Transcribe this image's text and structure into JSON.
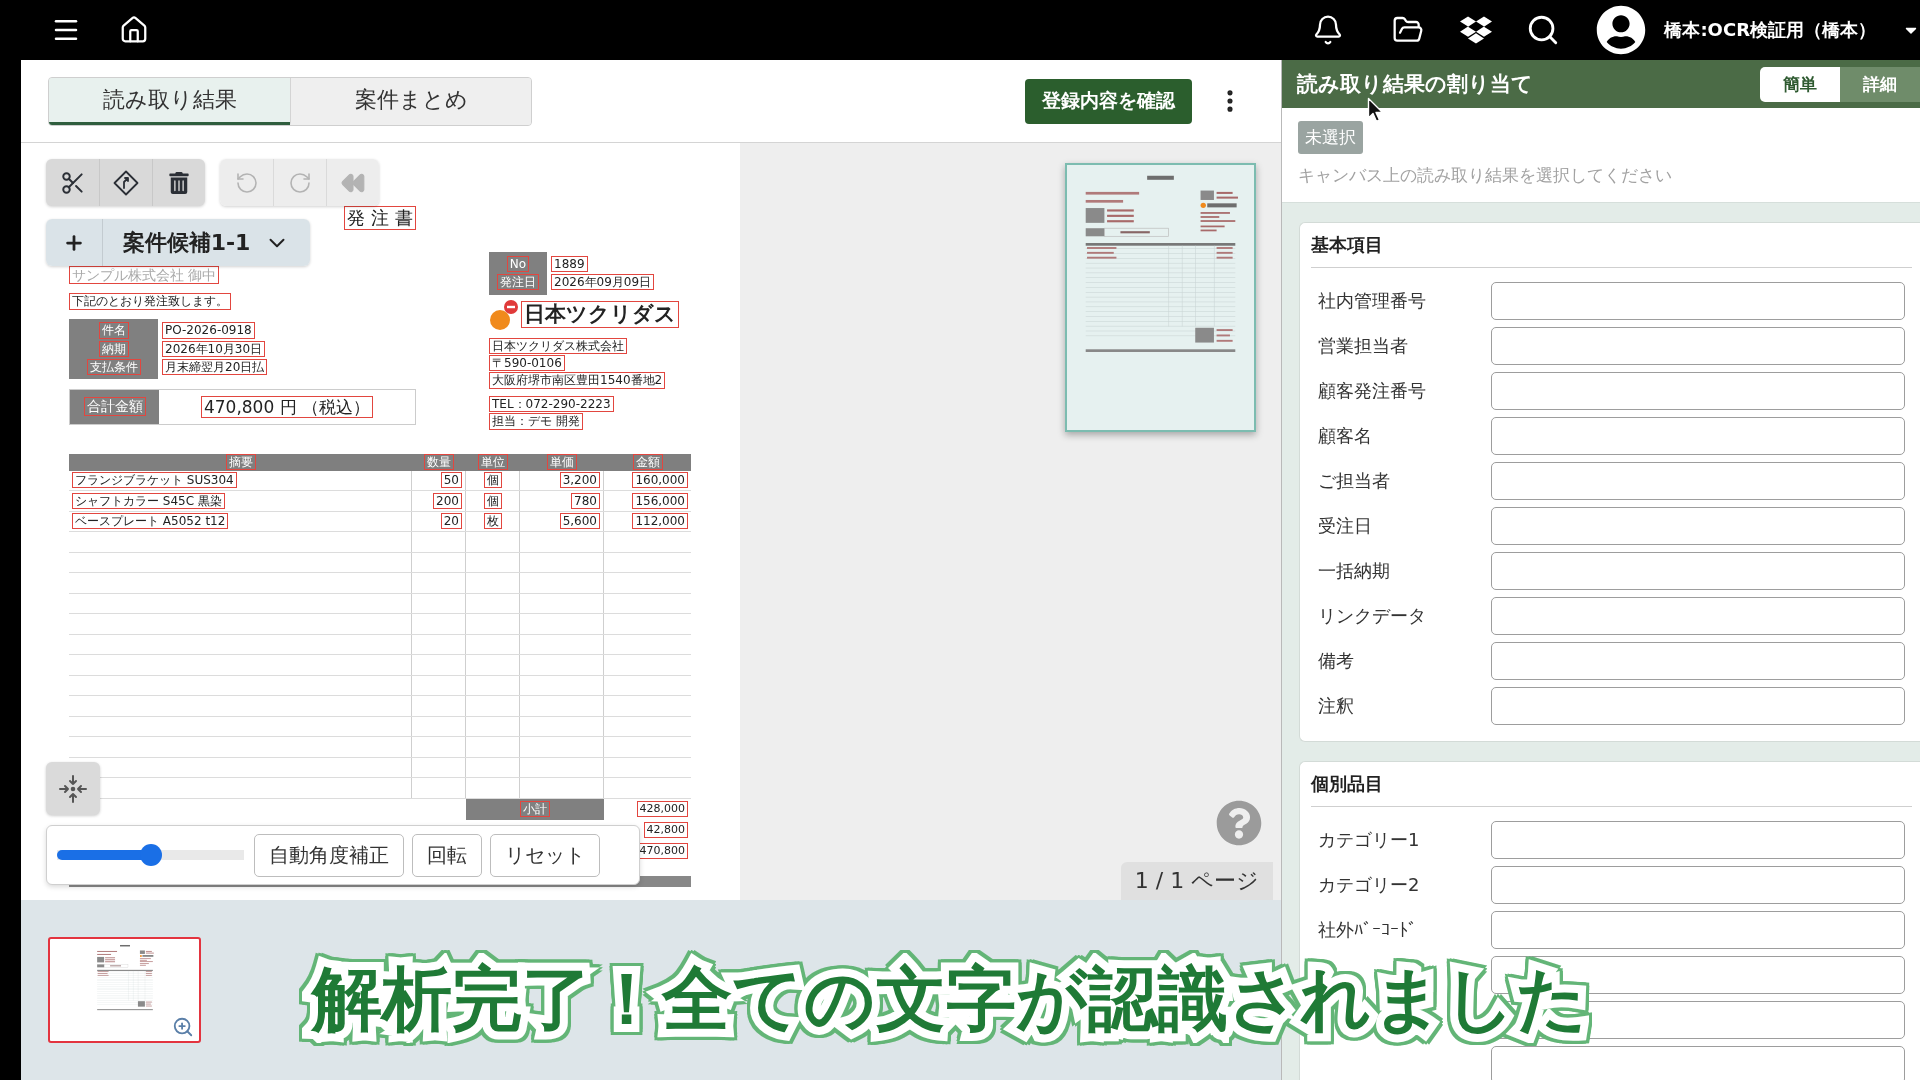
{
  "top_bar": {
    "user_name": "橋本:OCR検証用（橋本）"
  },
  "main_tabs": [
    {
      "label": "読み取り結果",
      "selected": true
    },
    {
      "label": "案件まとめ",
      "selected": false
    }
  ],
  "confirm_button": "登録内容を確認",
  "toolbar_groups": [
    [
      {
        "kind": "scissors",
        "disabled": false
      },
      {
        "kind": "diamond-arrow",
        "disabled": false
      },
      {
        "kind": "trash",
        "disabled": false
      }
    ],
    [
      {
        "kind": "undo",
        "disabled": true
      },
      {
        "kind": "redo",
        "disabled": true
      },
      {
        "kind": "rewind",
        "disabled": true
      }
    ]
  ],
  "candidate_select": {
    "value": "案件候補1-1"
  },
  "document": {
    "title": "発 注 書",
    "recipient": "サンプル株式会社 御中",
    "intro": "下記のとおり発注致します。",
    "details": [
      {
        "label": "件名",
        "value": "PO-2026-0918"
      },
      {
        "label": "納期",
        "value": "2026年10月30日"
      },
      {
        "label": "支払条件",
        "value": "月末締翌月20日払"
      }
    ],
    "total": {
      "label": "合計金額",
      "value": "470,800 円 （税込）"
    },
    "meta": [
      {
        "label": "No",
        "value": "1889"
      },
      {
        "label": "発注日",
        "value": "2026年09月09日"
      }
    ],
    "company_logo": "日本ツクリダス",
    "company_blocks": [
      [
        "日本ツクリダス株式会社",
        "〒590-0106",
        "大阪府堺市南区豊田1540番地2"
      ],
      [
        "TEL：072-290-2223",
        "担当：デモ 開発"
      ]
    ],
    "table": {
      "columns": [
        "摘要",
        "数量",
        "単位",
        "単価",
        "金額"
      ],
      "rows": [
        [
          "フランジブラケット SUS304",
          "50",
          "個",
          "3,200",
          "160,000"
        ],
        [
          "シャフトカラー S45C 黒染",
          "200",
          "個",
          "780",
          "156,000"
        ],
        [
          "ベースプレート A5052 t12",
          "20",
          "枚",
          "5,600",
          "112,000"
        ]
      ]
    },
    "summary": [
      {
        "label": "小計",
        "value": "428,000"
      },
      {
        "value": "42,800"
      },
      {
        "value": "470,800"
      }
    ]
  },
  "rotation": {
    "level": 0.5,
    "buttons": [
      "自動角度補正",
      "回転",
      "リセット"
    ]
  },
  "page_indicator": "1 / 1 ページ",
  "assign_panel": {
    "title": "読み取り結果の割り当て",
    "modes": [
      {
        "label": "簡単",
        "selected": true
      },
      {
        "label": "詳細",
        "selected": false
      }
    ],
    "status_badge": "未選択",
    "hint": "キャンバス上の読み取り結果を選択してください",
    "sections": [
      {
        "title": "基本項目",
        "fields": [
          {
            "kind": "labelled",
            "label": "社内管理番号"
          },
          {
            "kind": "labelled",
            "label": "営業担当者"
          },
          {
            "kind": "labelled",
            "label": "顧客発注番号"
          },
          {
            "kind": "labelled",
            "label": "顧客名"
          },
          {
            "kind": "labelled",
            "label": "ご担当者"
          },
          {
            "kind": "labelled",
            "label": "受注日"
          },
          {
            "kind": "labelled",
            "label": "一括納期"
          },
          {
            "kind": "labelled",
            "label": "リンクデータ"
          },
          {
            "kind": "labelled",
            "label": "備考"
          },
          {
            "kind": "labelled",
            "label": "注釈"
          }
        ]
      },
      {
        "title": "個別品目",
        "fields": [
          {
            "kind": "labelled",
            "label": "カテゴリー1"
          },
          {
            "kind": "labelled",
            "label": "カテゴリー2"
          },
          {
            "kind": "labelled",
            "label": "社外ﾊﾞｰｺｰﾄﾞ"
          },
          {
            "kind": "unlabelled"
          },
          {
            "kind": "unlabelled"
          },
          {
            "kind": "unlabelled"
          }
        ]
      }
    ]
  },
  "caption": "解析完了！全ての文字が認識されました"
}
